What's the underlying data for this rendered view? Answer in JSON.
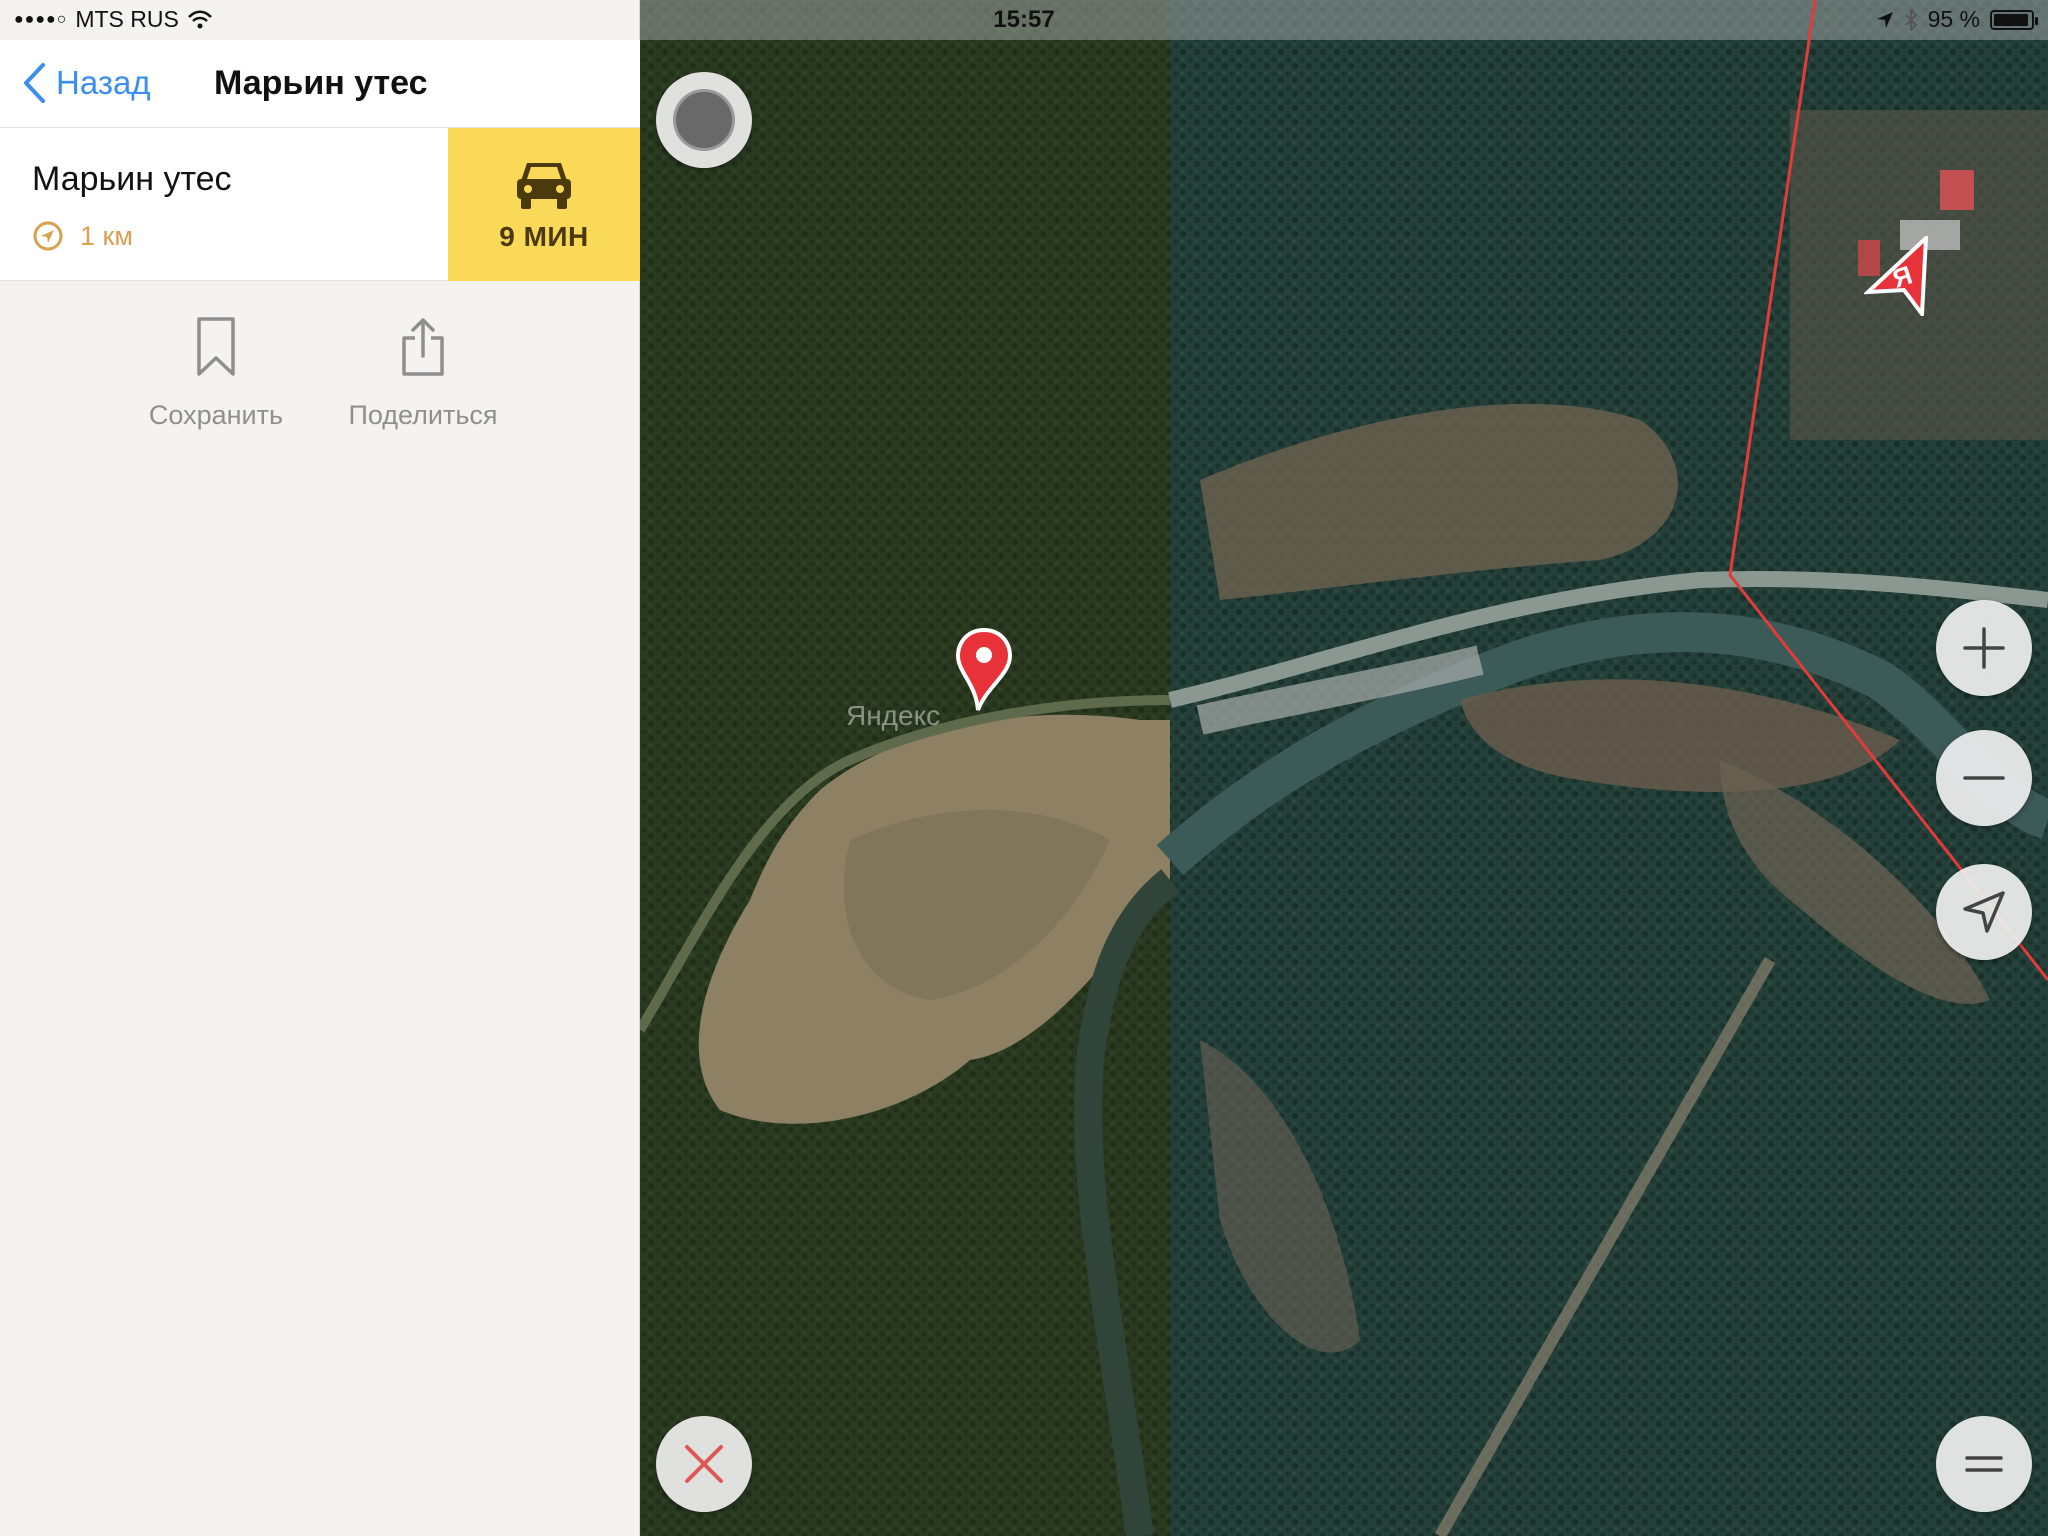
{
  "status_bar": {
    "signal_dots": "●●●●○",
    "carrier": "MTS RUS",
    "time": "15:57",
    "battery_percent": "95 %",
    "battery_level": 0.95
  },
  "nav": {
    "back_label": "Назад",
    "title": "Марьин утес"
  },
  "place": {
    "name": "Марьин утес",
    "distance": "1 км",
    "route_time": "9 МИН"
  },
  "actions": {
    "save_label": "Сохранить",
    "share_label": "Поделиться"
  },
  "map": {
    "watermark": "Яндекс",
    "me_marker_letter": "Я"
  },
  "colors": {
    "accent": "#3b8df0",
    "route_button": "#fbd958",
    "distance": "#d9a050",
    "pin": "#e8323a",
    "boundary": "#e23b3b"
  },
  "icons": {
    "back": "chevron-left-icon",
    "distance": "navigation-arrow-icon",
    "route": "car-icon",
    "save": "bookmark-icon",
    "share": "share-icon",
    "layers": "layers-icon",
    "close": "close-icon",
    "zoom_in": "plus-icon",
    "zoom_out": "minus-icon",
    "locate": "location-arrow-icon",
    "menu": "menu-icon"
  }
}
